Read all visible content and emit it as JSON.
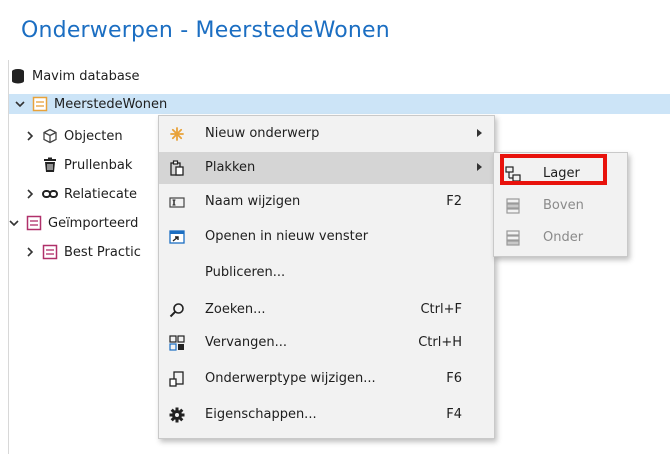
{
  "page": {
    "title": "Onderwerpen - MeerstedeWonen"
  },
  "tree": {
    "root": "Mavim database",
    "items": [
      {
        "label": "MeerstedeWonen",
        "icon": "topic-icon"
      },
      {
        "label": "Objecten",
        "icon": "objects-icon"
      },
      {
        "label": "Prullenbak",
        "icon": "trash-icon"
      },
      {
        "label": "Relatiecate",
        "icon": "relation-icon"
      },
      {
        "label": "Geïmporteerd",
        "icon": "topic-icon"
      },
      {
        "label": "Best Practic",
        "icon": "topic-icon"
      }
    ]
  },
  "context_menu": {
    "items": [
      {
        "label": "Nieuw onderwerp",
        "shortcut": "",
        "icon": "new-asterisk-icon"
      },
      {
        "label": "Plakken",
        "shortcut": "",
        "icon": "paste-icon"
      },
      {
        "label": "Naam wijzigen",
        "shortcut": "F2",
        "icon": "rename-icon"
      },
      {
        "label": "Openen in nieuw venster",
        "shortcut": "",
        "icon": "open-window-icon"
      },
      {
        "label": "Publiceren...",
        "shortcut": "",
        "icon": ""
      },
      {
        "label": "Zoeken...",
        "shortcut": "Ctrl+F",
        "icon": "search-icon"
      },
      {
        "label": "Vervangen...",
        "shortcut": "Ctrl+H",
        "icon": "replace-icon"
      },
      {
        "label": "Onderwerptype wijzigen...",
        "shortcut": "F6",
        "icon": "change-type-icon"
      },
      {
        "label": "Eigenschappen...",
        "shortcut": "F4",
        "icon": "gear-icon"
      }
    ]
  },
  "submenu": {
    "items": [
      {
        "label": "Lager",
        "enabled": true,
        "icon": "paste-lower-icon"
      },
      {
        "label": "Boven",
        "enabled": false,
        "icon": "paste-above-icon"
      },
      {
        "label": "Onder",
        "enabled": false,
        "icon": "paste-below-icon"
      }
    ]
  },
  "colors": {
    "accent": "#1b6ec2",
    "selection": "#cce4f7",
    "topic_icon": "#e8a23a",
    "highlight": "#e8120c"
  }
}
